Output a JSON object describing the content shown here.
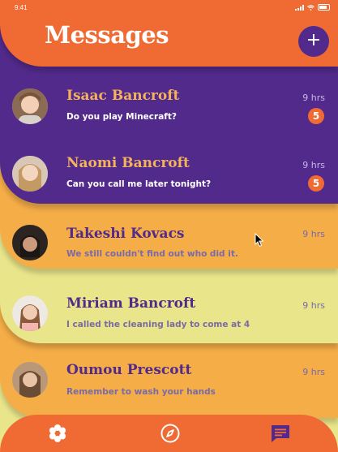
{
  "status_bar": {
    "time": "9:41"
  },
  "header": {
    "title": "Messages",
    "compose_label": "+"
  },
  "chats": [
    {
      "name": "Isaac Bancroft",
      "message": "Do you play Minecraft?",
      "time": "9 hrs",
      "unread": "5"
    },
    {
      "name": "Naomi Bancroft",
      "message": "Can you call me later tonight?",
      "time": "9 hrs",
      "unread": "5"
    },
    {
      "name": "Takeshi Kovacs",
      "message": "We still couldn't find out who did it.",
      "time": "9 hrs"
    },
    {
      "name": "Miriam Bancroft",
      "message": "I called the cleaning lady to come at 4",
      "time": "9 hrs"
    },
    {
      "name": "Oumou Prescott",
      "message": "Remember to wash your hands",
      "time": "9 hrs"
    }
  ],
  "colors": {
    "header": "#f06a33",
    "purple": "#522a8c",
    "orange": "#f4ad47",
    "yellow": "#e9e58a",
    "name_on_purple": "#f4b25a",
    "time_light": "#c9b7e6"
  },
  "bottom_nav": {
    "icons": [
      "settings-icon",
      "explore-icon",
      "messages-icon"
    ],
    "active": "messages-icon"
  }
}
